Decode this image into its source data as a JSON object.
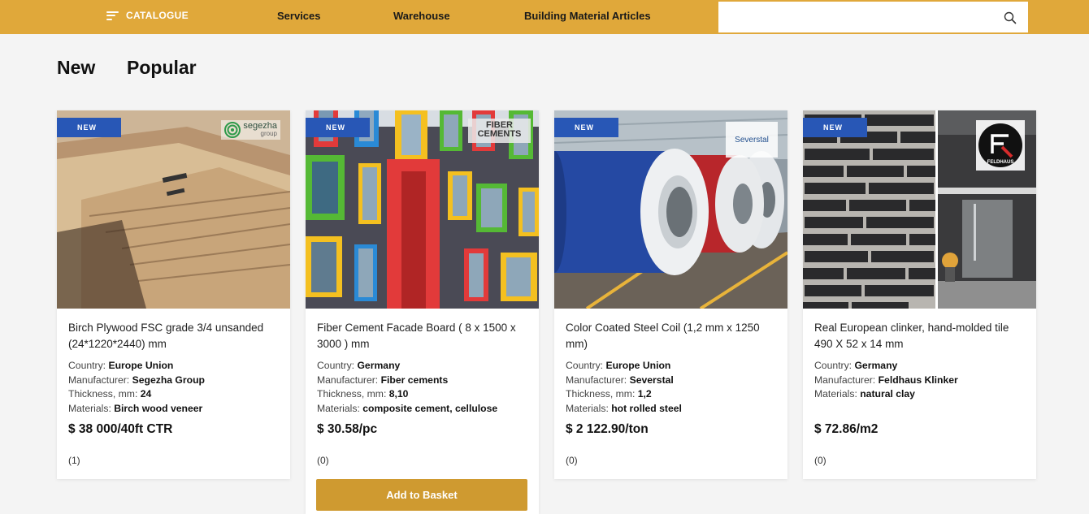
{
  "topbar": {
    "catalogue_label": "CATALOGUE",
    "nav": [
      "Services",
      "Warehouse",
      "Building Material Articles"
    ],
    "search_placeholder": "",
    "accent": "#e0a83a"
  },
  "tabs": [
    "New",
    "Popular"
  ],
  "product_badge": "NEW",
  "labels": {
    "country": "Country:",
    "manufacturer": "Manufacturer:",
    "thickness": "Thickness, mm:",
    "materials": "Materials:"
  },
  "products": [
    {
      "title": "Birch Plywood FSC grade 3/4 unsanded (24*1220*2440) mm",
      "country": "Europe Union",
      "manufacturer": "Segezha Group",
      "thickness": "24",
      "materials": "Birch wood veneer",
      "price": "$ 38 000/40ft CTR",
      "reviews": "(1)",
      "logo_text": "segezha",
      "logo_sub": "group"
    },
    {
      "title": "Fiber Cement Facade Board ( 8 x 1500 x 3000 ) mm",
      "country": "Germany",
      "manufacturer": "Fiber cements",
      "thickness": "8,10",
      "materials": "composite cement, cellulose",
      "price": "$ 30.58/pc",
      "reviews": "(0)",
      "logo_text": "FIBER",
      "logo_sub": "CEMENTS",
      "button": "Add to Basket"
    },
    {
      "title": "Color Coated Steel Coil (1,2 mm x 1250 mm)",
      "country": "Europe Union",
      "manufacturer": "Severstal",
      "thickness": "1,2",
      "materials": "hot rolled steel",
      "price": "$ 2 122.90/ton",
      "reviews": "(0)",
      "logo_text": "Severstal"
    },
    {
      "title": "Real European clinker, hand-molded tile 490 X 52 x 14 mm",
      "country": "Germany",
      "manufacturer": "Feldhaus Klinker",
      "materials": "natural clay",
      "price": "$ 72.86/m2",
      "reviews": "(0)",
      "logo_text": "FELDHAUS"
    }
  ]
}
